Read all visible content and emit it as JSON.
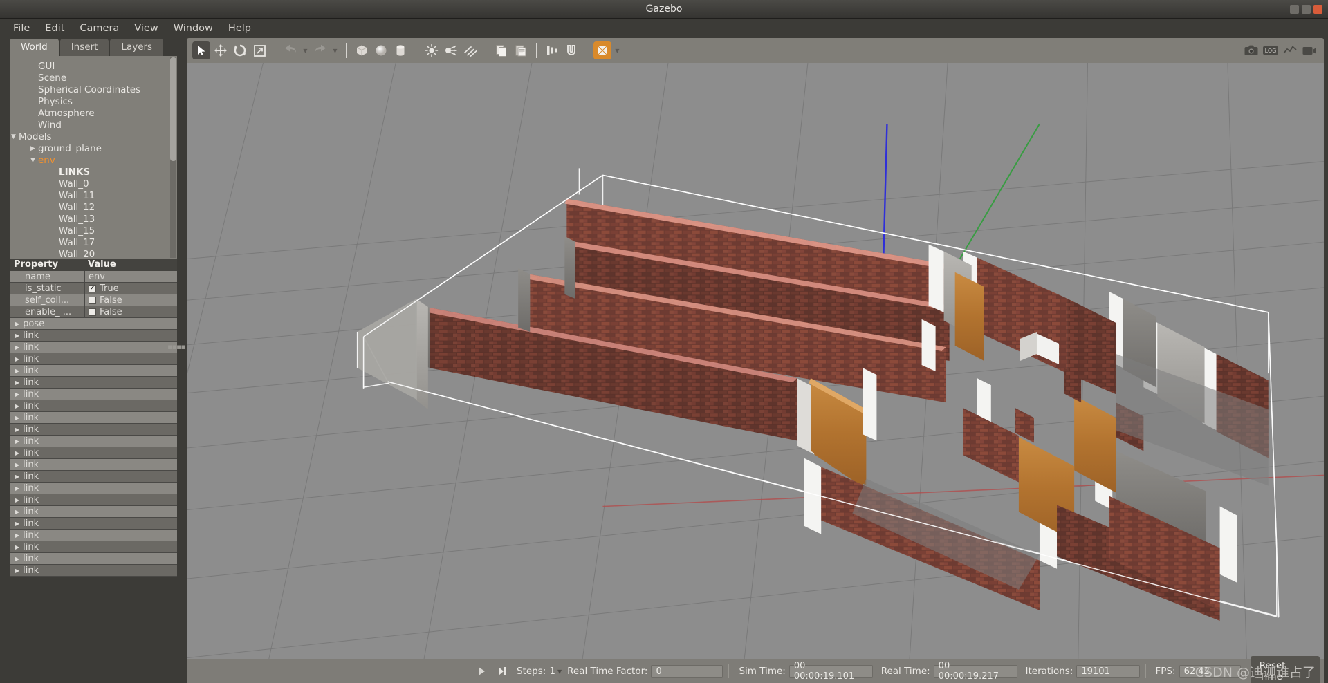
{
  "window": {
    "title": "Gazebo",
    "controls": [
      "minimize",
      "maximize",
      "close"
    ]
  },
  "menubar": {
    "items": [
      {
        "label": "File",
        "mnemonic": "F"
      },
      {
        "label": "Edit",
        "mnemonic": "E"
      },
      {
        "label": "Camera",
        "mnemonic": "C"
      },
      {
        "label": "View",
        "mnemonic": "V"
      },
      {
        "label": "Window",
        "mnemonic": "W"
      },
      {
        "label": "Help",
        "mnemonic": "H"
      }
    ]
  },
  "left_panel": {
    "tabs": [
      {
        "label": "World",
        "active": true
      },
      {
        "label": "Insert",
        "active": false
      },
      {
        "label": "Layers",
        "active": false
      }
    ],
    "tree": [
      {
        "label": "GUI",
        "indent": 1,
        "arrow": "",
        "selected": false
      },
      {
        "label": "Scene",
        "indent": 1,
        "arrow": "",
        "selected": false
      },
      {
        "label": "Spherical Coordinates",
        "indent": 1,
        "arrow": "",
        "selected": false
      },
      {
        "label": "Physics",
        "indent": 1,
        "arrow": "",
        "selected": false
      },
      {
        "label": "Atmosphere",
        "indent": 1,
        "arrow": "",
        "selected": false
      },
      {
        "label": "Wind",
        "indent": 1,
        "arrow": "",
        "selected": false
      },
      {
        "label": "Models",
        "indent": 0,
        "arrow": "down",
        "selected": false
      },
      {
        "label": "ground_plane",
        "indent": 1,
        "arrow": "right",
        "selected": false
      },
      {
        "label": "env",
        "indent": 1,
        "arrow": "down",
        "selected": true
      },
      {
        "label": "LINKS",
        "indent": 3,
        "arrow": "",
        "selected": false,
        "bold": true
      },
      {
        "label": "Wall_0",
        "indent": 3,
        "arrow": "",
        "selected": false
      },
      {
        "label": "Wall_11",
        "indent": 3,
        "arrow": "",
        "selected": false
      },
      {
        "label": "Wall_12",
        "indent": 3,
        "arrow": "",
        "selected": false
      },
      {
        "label": "Wall_13",
        "indent": 3,
        "arrow": "",
        "selected": false
      },
      {
        "label": "Wall_15",
        "indent": 3,
        "arrow": "",
        "selected": false
      },
      {
        "label": "Wall_17",
        "indent": 3,
        "arrow": "",
        "selected": false
      },
      {
        "label": "Wall_20",
        "indent": 3,
        "arrow": "",
        "selected": false
      }
    ],
    "property_table": {
      "headers": {
        "property": "Property",
        "value": "Value"
      },
      "rows": [
        {
          "name": "name",
          "value": "env",
          "type": "text"
        },
        {
          "name": "is_static",
          "value": "True",
          "type": "checkbox",
          "checked": true
        },
        {
          "name": "self_coll...",
          "value": "False",
          "type": "checkbox",
          "checked": false
        },
        {
          "name": "enable_ ...",
          "value": "False",
          "type": "checkbox",
          "checked": false
        },
        {
          "name": "pose",
          "value": "",
          "type": "expander"
        },
        {
          "name": "link",
          "value": "",
          "type": "expander"
        },
        {
          "name": "link",
          "value": "",
          "type": "expander"
        },
        {
          "name": "link",
          "value": "",
          "type": "expander"
        },
        {
          "name": "link",
          "value": "",
          "type": "expander"
        },
        {
          "name": "link",
          "value": "",
          "type": "expander"
        },
        {
          "name": "link",
          "value": "",
          "type": "expander"
        },
        {
          "name": "link",
          "value": "",
          "type": "expander"
        },
        {
          "name": "link",
          "value": "",
          "type": "expander"
        },
        {
          "name": "link",
          "value": "",
          "type": "expander"
        },
        {
          "name": "link",
          "value": "",
          "type": "expander"
        },
        {
          "name": "link",
          "value": "",
          "type": "expander"
        },
        {
          "name": "link",
          "value": "",
          "type": "expander"
        },
        {
          "name": "link",
          "value": "",
          "type": "expander"
        },
        {
          "name": "link",
          "value": "",
          "type": "expander"
        },
        {
          "name": "link",
          "value": "",
          "type": "expander"
        },
        {
          "name": "link",
          "value": "",
          "type": "expander"
        },
        {
          "name": "link",
          "value": "",
          "type": "expander"
        },
        {
          "name": "link",
          "value": "",
          "type": "expander"
        },
        {
          "name": "link",
          "value": "",
          "type": "expander"
        },
        {
          "name": "link",
          "value": "",
          "type": "expander"
        },
        {
          "name": "link",
          "value": "",
          "type": "expander"
        }
      ]
    }
  },
  "toolbar": {
    "buttons": [
      {
        "icon": "select-arrow-icon",
        "active": true
      },
      {
        "icon": "translate-move-icon",
        "active": false
      },
      {
        "icon": "rotate-icon",
        "active": false
      },
      {
        "icon": "scale-icon",
        "active": false
      },
      {
        "icon": "undo-icon",
        "active": false,
        "caret": true
      },
      {
        "icon": "redo-icon",
        "active": false,
        "caret": true
      },
      {
        "icon": "box-icon",
        "active": false
      },
      {
        "icon": "sphere-icon",
        "active": false
      },
      {
        "icon": "cylinder-icon",
        "active": false
      },
      {
        "icon": "point-light-icon",
        "active": false
      },
      {
        "icon": "spot-light-icon",
        "active": false
      },
      {
        "icon": "directional-light-icon",
        "active": false
      },
      {
        "icon": "copy-icon",
        "active": false
      },
      {
        "icon": "paste-icon",
        "active": false
      },
      {
        "icon": "align-icon",
        "active": false
      },
      {
        "icon": "snap-icon",
        "active": false
      },
      {
        "icon": "view-angle-icon",
        "active": false,
        "highlight": "#d98a2b",
        "caret": true
      }
    ],
    "right_buttons": [
      {
        "icon": "screenshot-camera-icon"
      },
      {
        "icon": "log-record-icon"
      },
      {
        "icon": "plot-icon"
      },
      {
        "icon": "video-record-icon"
      }
    ]
  },
  "statusbar": {
    "play_button": "play-icon",
    "step_button": "step-forward-icon",
    "steps_label": "Steps:",
    "steps_value": "1",
    "real_time_factor_label": "Real Time Factor:",
    "real_time_factor_value": "0",
    "sim_time_label": "Sim Time:",
    "sim_time_value": "00 00:00:19.101",
    "real_time_label": "Real Time:",
    "real_time_value": "00 00:00:19.217",
    "iterations_label": "Iterations:",
    "iterations_value": "19101",
    "fps_label": "FPS:",
    "fps_value": "62.42",
    "reset_time_label": "Reset Time",
    "watermark": "CSDN @迪迦谁占了"
  },
  "colors": {
    "accent_orange": "#f0912f",
    "panel_bg": "#3c3b37",
    "tree_bg": "#817f79",
    "toolbar_bg": "#807e78",
    "viewport_bg": "#8d8d8d"
  }
}
